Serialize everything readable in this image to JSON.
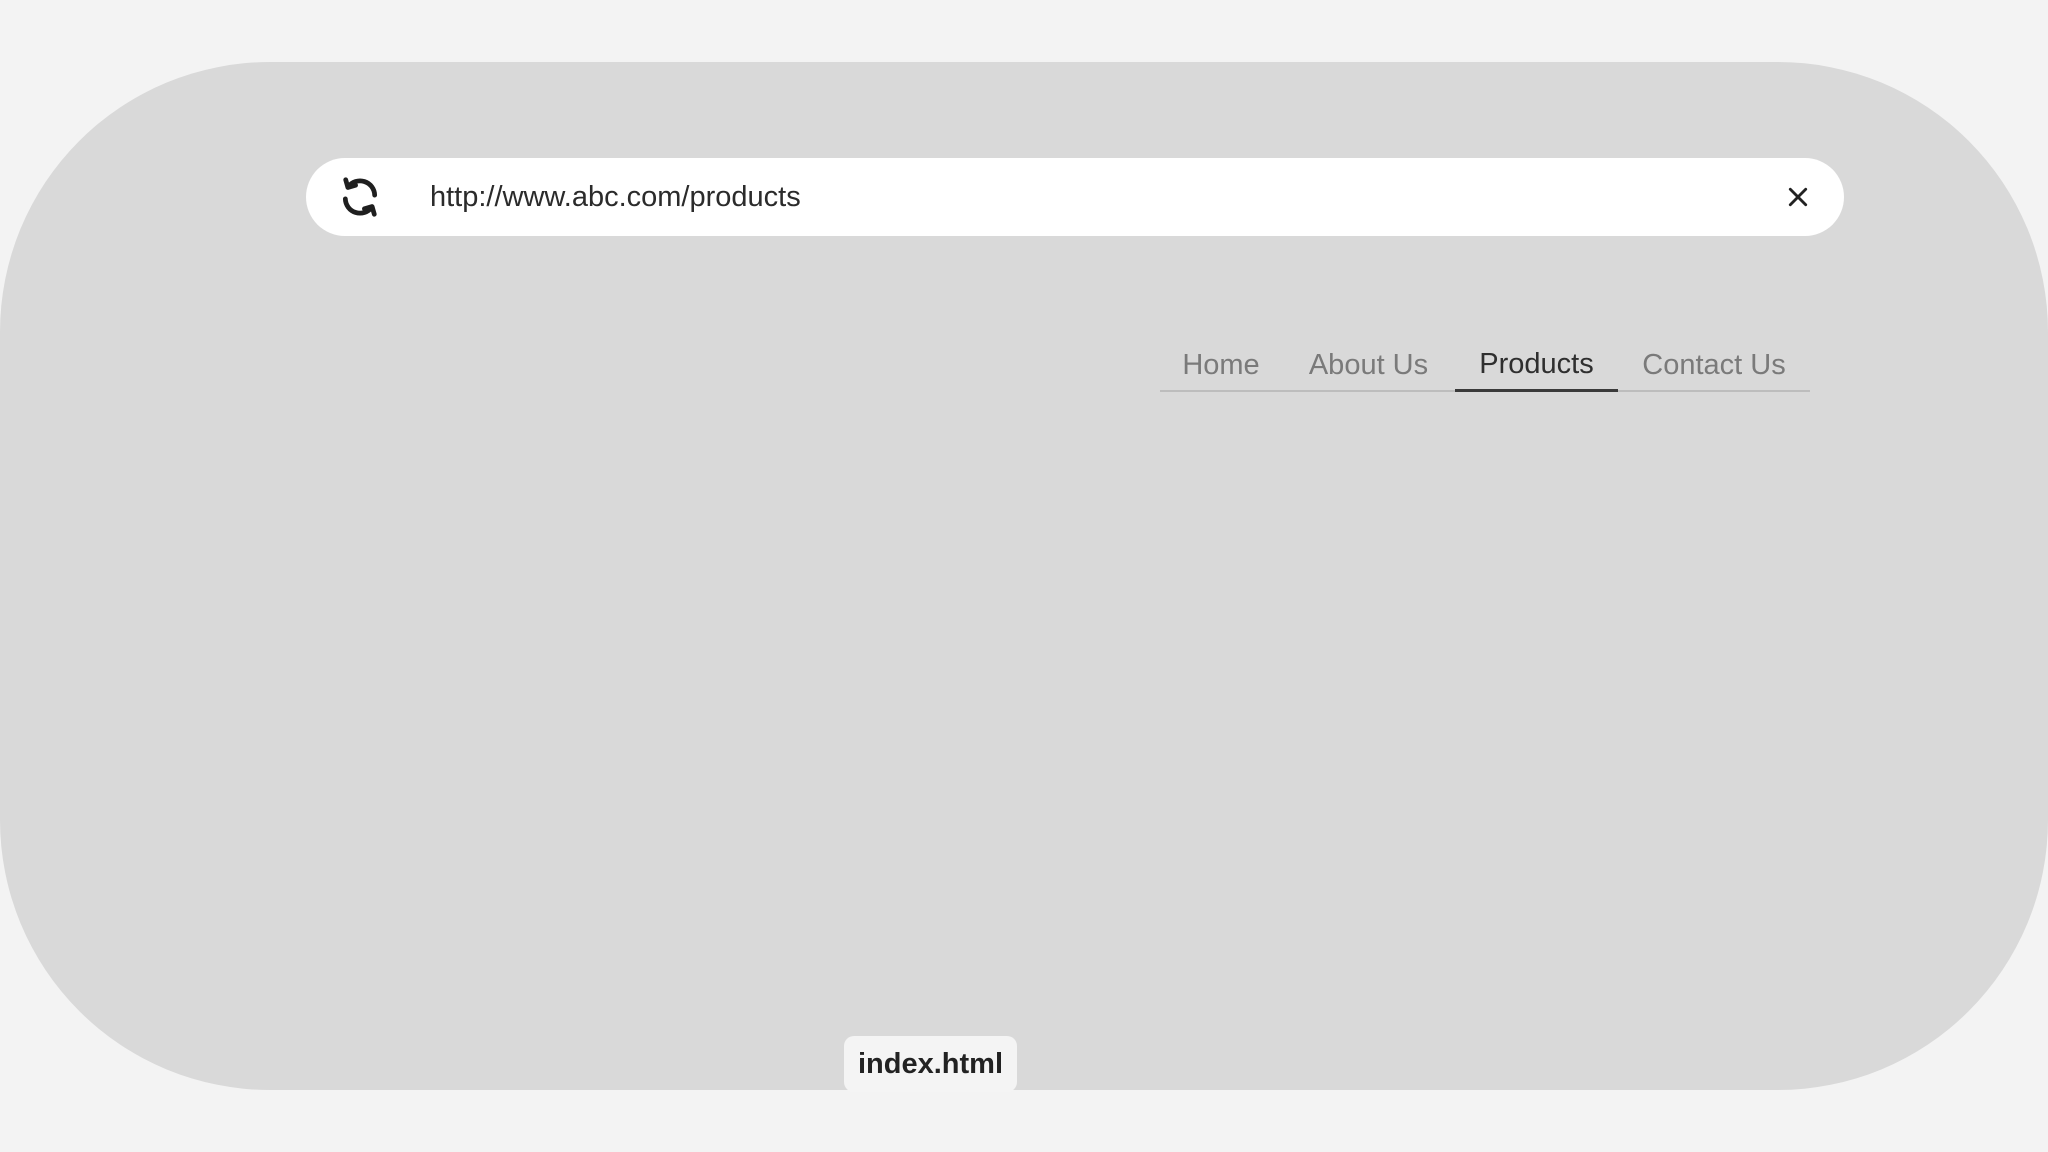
{
  "browser": {
    "url": "http://www.abc.com/products",
    "reload_icon": "reload-icon",
    "close_icon": "close-icon"
  },
  "nav": {
    "tabs": [
      {
        "label": "Home",
        "active": false
      },
      {
        "label": "About Us",
        "active": false
      },
      {
        "label": "Products",
        "active": true
      },
      {
        "label": "Contact Us",
        "active": false
      }
    ]
  },
  "file": {
    "name": "index.html"
  },
  "colors": {
    "page_background": "#f3f3f3",
    "frame_background": "#d9d9d9",
    "address_bar": "#ffffff",
    "active_tab": "#2f2f2f",
    "inactive_tab": "#7a7a7a"
  }
}
